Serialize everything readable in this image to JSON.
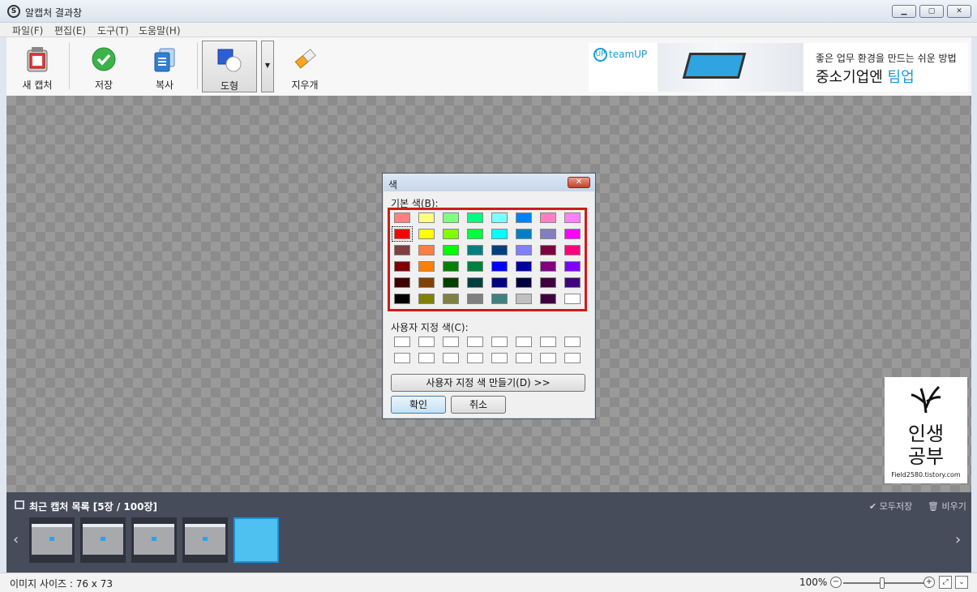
{
  "window": {
    "title": "알캡처 결과창"
  },
  "menu": [
    "파일(F)",
    "편집(E)",
    "도구(T)",
    "도움말(H)"
  ],
  "toolbar": {
    "new_capture": "새 캡처",
    "save": "저장",
    "copy": "복사",
    "shape": "도형",
    "eraser": "지우개"
  },
  "banner": {
    "logo": "teamUP",
    "line1": "좋은 업무 환경을 만드는 쉬운 방법",
    "line2a": "중소기업엔 ",
    "line2b": "팀업"
  },
  "color_dialog": {
    "title": "색",
    "basic_label": "기본 색(B):",
    "custom_label": "사용자 지정 색(C):",
    "define_button": "사용자 지정 색 만들기(D) >>",
    "ok_button": "확인",
    "cancel_button": "취소",
    "basic_colors": [
      [
        "#ff8080",
        "#ffff80",
        "#80ff80",
        "#00ff80",
        "#80ffff",
        "#0080ff",
        "#ff80c0",
        "#ff80ff"
      ],
      [
        "#ff0000",
        "#ffff00",
        "#80ff00",
        "#00ff40",
        "#00ffff",
        "#0080c0",
        "#8080c0",
        "#ff00ff"
      ],
      [
        "#804040",
        "#ff8040",
        "#00ff00",
        "#008080",
        "#004080",
        "#8080ff",
        "#800040",
        "#ff0080"
      ],
      [
        "#800000",
        "#ff8000",
        "#008000",
        "#008040",
        "#0000ff",
        "#0000a0",
        "#800080",
        "#8000ff"
      ],
      [
        "#400000",
        "#804000",
        "#004000",
        "#004040",
        "#000080",
        "#000040",
        "#400040",
        "#400080"
      ],
      [
        "#000000",
        "#808000",
        "#808040",
        "#808080",
        "#408080",
        "#c0c0c0",
        "#400040",
        "#ffffff"
      ]
    ],
    "selected_color": "#ff0000"
  },
  "stamp": {
    "line1": "인생",
    "line2": "공부",
    "url": "Field2580.tistory.com"
  },
  "recent": {
    "title": "최근 캡처 목록",
    "count": "[5장 / 100장]",
    "save_all": "모두저장",
    "clear": "비우기"
  },
  "status": {
    "image_size": "이미지 사이즈 : 76 x 73",
    "zoom": "100%"
  }
}
